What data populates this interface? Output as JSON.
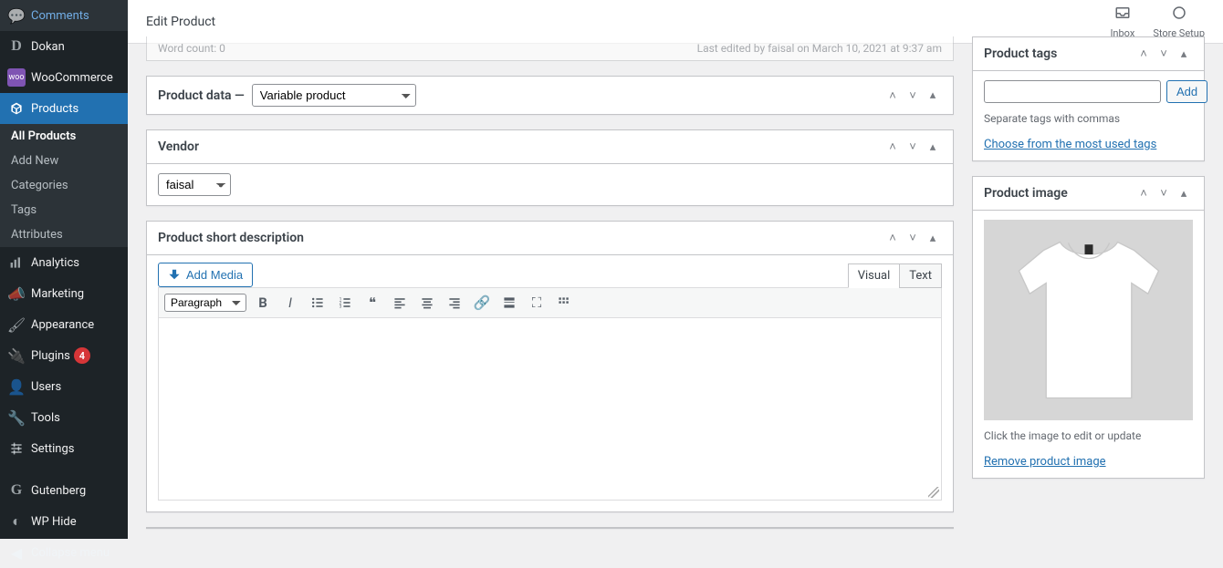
{
  "topbar": {
    "title": "Edit Product",
    "inbox": "Inbox",
    "store_setup": "Store Setup"
  },
  "sidebar": {
    "items": [
      {
        "label": "Comments",
        "icon": "💬"
      },
      {
        "label": "Dokan",
        "icon": "D"
      },
      {
        "label": "WooCommerce",
        "icon": "woo"
      },
      {
        "label": "Products",
        "icon": "◆",
        "active": true
      },
      {
        "label": "Analytics",
        "icon": "📊"
      },
      {
        "label": "Marketing",
        "icon": "📣"
      },
      {
        "label": "Appearance",
        "icon": "🖌"
      },
      {
        "label": "Plugins",
        "icon": "🔌",
        "badge": "4"
      },
      {
        "label": "Users",
        "icon": "👤"
      },
      {
        "label": "Tools",
        "icon": "🔧"
      },
      {
        "label": "Settings",
        "icon": "⚙"
      },
      {
        "label": "Gutenberg",
        "icon": "G"
      },
      {
        "label": "WP Hide",
        "icon": "◐"
      }
    ],
    "sub": [
      {
        "label": "All Products",
        "active": true
      },
      {
        "label": "Add New"
      },
      {
        "label": "Categories"
      },
      {
        "label": "Tags"
      },
      {
        "label": "Attributes"
      }
    ],
    "collapse": "Collapse menu"
  },
  "word_count": {
    "label": "Word count: 0",
    "edited": "Last edited by faisal on March 10, 2021 at 9:37 am"
  },
  "product_data": {
    "label": "Product data",
    "select": "Variable product"
  },
  "vendor": {
    "title": "Vendor",
    "value": "faisal"
  },
  "short_desc": {
    "title": "Product short description",
    "add_media": "Add Media",
    "tab_visual": "Visual",
    "tab_text": "Text",
    "format": "Paragraph"
  },
  "tags": {
    "title": "Product tags",
    "add": "Add",
    "help": "Separate tags with commas",
    "choose": "Choose from the most used tags"
  },
  "image": {
    "title": "Product image",
    "help": "Click the image to edit or update",
    "remove": "Remove product image"
  }
}
